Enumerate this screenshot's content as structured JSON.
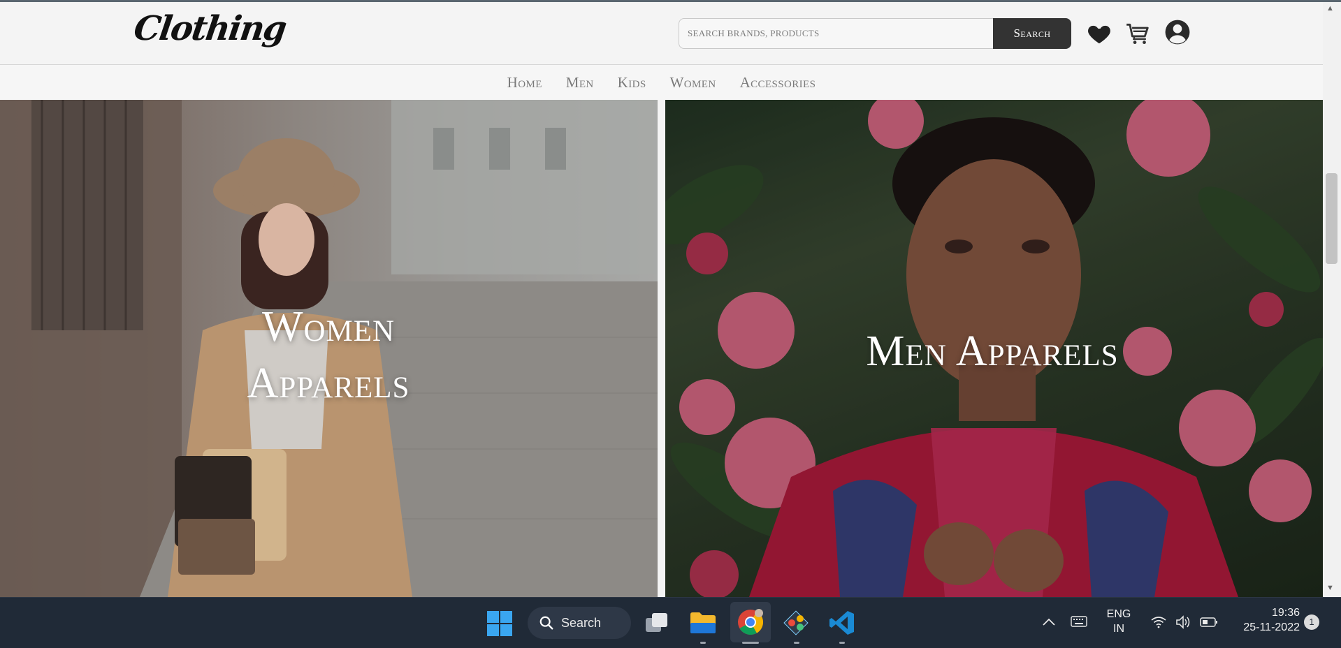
{
  "header": {
    "logo": "Clothing",
    "search_placeholder": "SEARCH BRANDS, PRODUCTS",
    "search_button": "Search"
  },
  "nav": {
    "items": [
      "Home",
      "Men",
      "Kids",
      "Women",
      "Accessories"
    ]
  },
  "hero": {
    "women_title_line1": "Women",
    "women_title_line2": "Apparels",
    "men_title": "Men Apparels"
  },
  "taskbar": {
    "search_label": "Search",
    "language_line1": "ENG",
    "language_line2": "IN",
    "time": "19:36",
    "date": "25-11-2022",
    "notification_count": "1"
  },
  "colors": {
    "search_button_bg": "#333333",
    "taskbar_bg": "#202a37",
    "nav_text": "#7a7a7a"
  }
}
